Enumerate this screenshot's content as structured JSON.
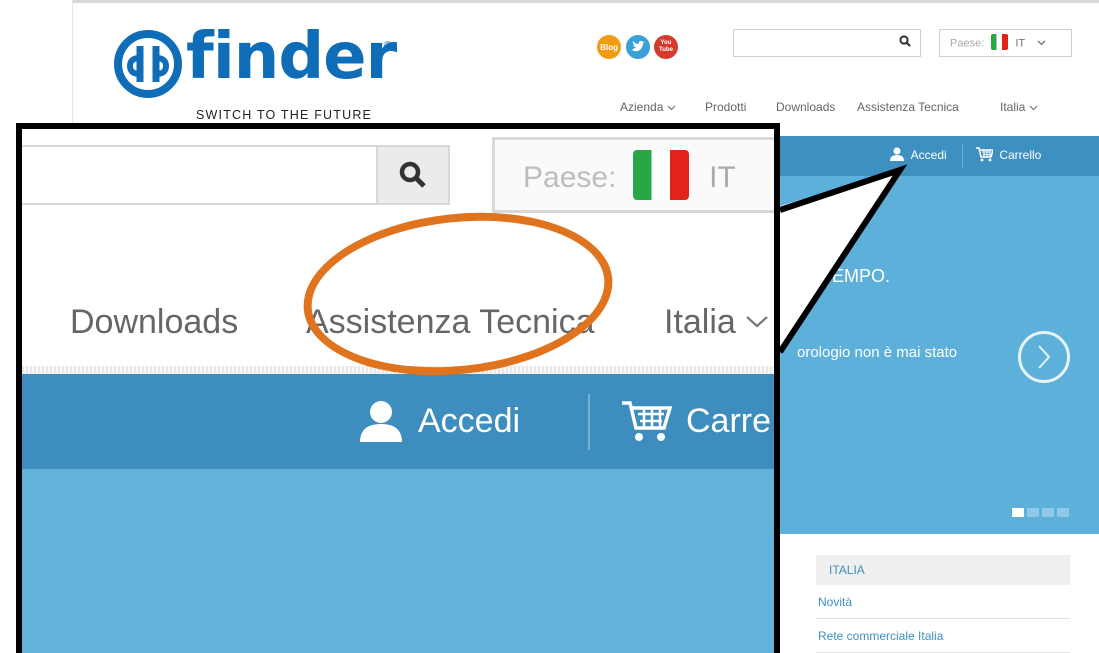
{
  "brand": {
    "logo_text": "finder",
    "registered_mark": "®",
    "tagline": "SWITCH TO THE FUTURE"
  },
  "header": {
    "social": [
      {
        "name": "blog",
        "label": "Blog",
        "color": "#f39c12"
      },
      {
        "name": "twitter",
        "label": "t",
        "color": "#3aa0d8"
      },
      {
        "name": "youtube",
        "label": "You Tube",
        "color": "#d63a2c"
      }
    ],
    "search": {
      "value": "",
      "placeholder": ""
    },
    "country": {
      "label": "Paese:",
      "code": "IT"
    },
    "nav": [
      "Azienda",
      "Prodotti",
      "Downloads",
      "Assistenza Tecnica",
      "Italia"
    ]
  },
  "account_bar": {
    "login_label": "Accedi",
    "cart_label": "Carrello"
  },
  "hero": {
    "title_fragment": "EMPO.",
    "subtitle_fragment": "orologio non è mai stato",
    "next_glyph": "›",
    "slides": 4,
    "active_slide": 1
  },
  "sidebar": {
    "heading": "ITALIA",
    "items": [
      "Novità",
      "Rete commerciale Italia"
    ]
  },
  "zoom": {
    "country_label": "Paese:",
    "country_code": "IT",
    "nav": [
      "Downloads",
      "Assistenza Tecnica",
      "Italia"
    ],
    "login_label": "Accedi",
    "cart_label_partial": "Carre"
  },
  "colors": {
    "brand_blue": "#0f6cb6",
    "bar_blue": "#3e90c0",
    "hero_blue": "#5cb0d9",
    "highlight_orange": "#e0741e"
  },
  "icons": [
    "search-icon",
    "chevron-down-icon",
    "user-icon",
    "cart-icon",
    "flag-italy-icon",
    "arrow-right-icon"
  ]
}
